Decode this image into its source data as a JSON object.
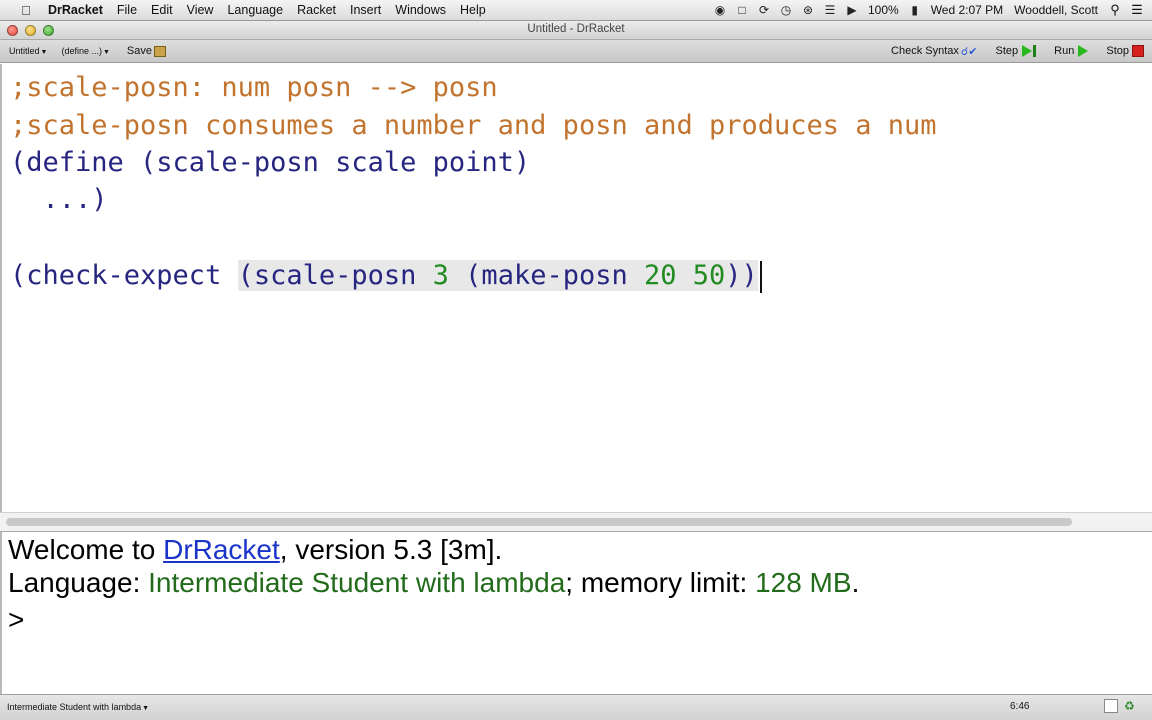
{
  "menubar": {
    "app_name": "DrRacket",
    "items": [
      "File",
      "Edit",
      "View",
      "Language",
      "Racket",
      "Insert",
      "Windows",
      "Help"
    ],
    "battery": "100%",
    "clock": "Wed 2:07 PM",
    "user": "Wooddell, Scott"
  },
  "window": {
    "title": "Untitled - DrRacket"
  },
  "toolbar": {
    "file_dropdown": "Untitled",
    "define_dropdown": "(define ...)",
    "save_label": "Save",
    "check_syntax_label": "Check Syntax",
    "step_label": "Step",
    "run_label": "Run",
    "stop_label": "Stop"
  },
  "editor": {
    "line1": ";scale-posn: num posn --> posn",
    "line2": ";scale-posn consumes a number and posn and produces a num",
    "line3": "(define (scale-posn scale point)",
    "line4": "  ...)",
    "line6_prefix": "(check-expect ",
    "line6_open": "(scale-posn ",
    "line6_num1": "3",
    "line6_mid": " (make-posn ",
    "line6_num2": "20",
    "line6_num3": "50",
    "line6_close": "))"
  },
  "repl": {
    "welcome_prefix": "Welcome to ",
    "welcome_link": "DrRacket",
    "welcome_suffix": ", version 5.3 [3m].",
    "language_prefix": "Language: ",
    "language_name": "Intermediate Student with lambda",
    "memory_prefix": "; memory limit: ",
    "memory_value": "128 MB",
    "memory_suffix": ".",
    "prompt": ">"
  },
  "status": {
    "language": "Intermediate Student with lambda",
    "position": "6:46"
  },
  "colors": {
    "comment": "#c2742f",
    "code": "#262680",
    "number": "#228b22",
    "repl_green": "#226b1b",
    "link": "#1a33c9"
  }
}
